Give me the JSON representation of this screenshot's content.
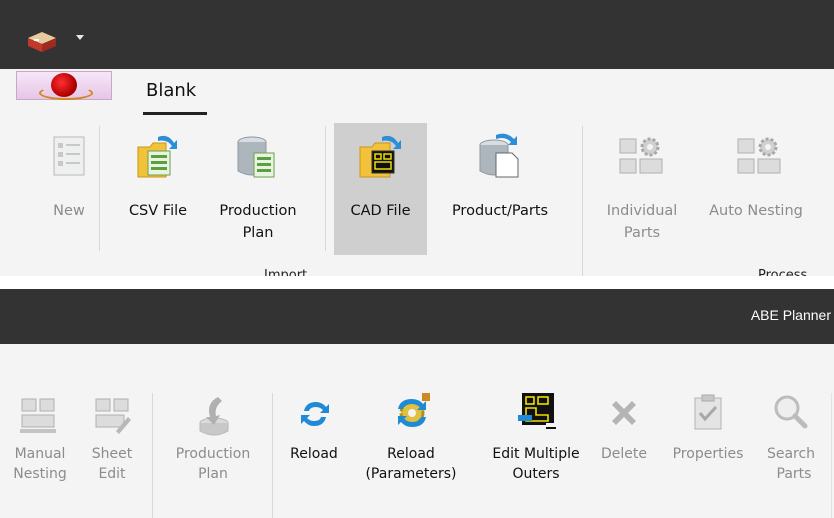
{
  "top": {
    "tab_label": "Blank",
    "buttons": {
      "new": "New",
      "csv_file": "CSV File",
      "production_plan": [
        "Production",
        "Plan"
      ],
      "cad_file": "CAD File",
      "product_parts": "Product/Parts",
      "individual_parts": [
        "Individual",
        "Parts"
      ],
      "auto_nesting": "Auto Nesting"
    },
    "group_labels": {
      "import": "Import",
      "process": "Process"
    }
  },
  "bottom": {
    "window_title": "ABE Planner",
    "buttons": {
      "manual_nesting": [
        "Manual",
        "Nesting"
      ],
      "sheet_edit": [
        "Sheet",
        "Edit"
      ],
      "production_plan": [
        "Production",
        "Plan"
      ],
      "reload": "Reload",
      "reload_parameters": [
        "Reload",
        "(Parameters)"
      ],
      "edit_multiple_outers": [
        "Edit Multiple",
        "Outers"
      ],
      "delete": "Delete",
      "properties": "Properties",
      "search_parts": [
        "Search",
        "Parts"
      ]
    }
  },
  "colors": {
    "titlebar": "#333333",
    "ribbon": "#f4f4f4",
    "selected": "#cfcfcf",
    "disabled_text": "#8c8c8c"
  },
  "icons": [
    "app-logo-icon",
    "new-doc-icon",
    "csv-folder-icon",
    "database-icon",
    "cad-folder-icon",
    "product-parts-icon",
    "nesting-gear-icon",
    "sheet-edit-icon",
    "production-plan-icon",
    "reload-icon",
    "reload-params-icon",
    "edit-outers-icon",
    "delete-icon",
    "properties-icon",
    "search-icon"
  ]
}
